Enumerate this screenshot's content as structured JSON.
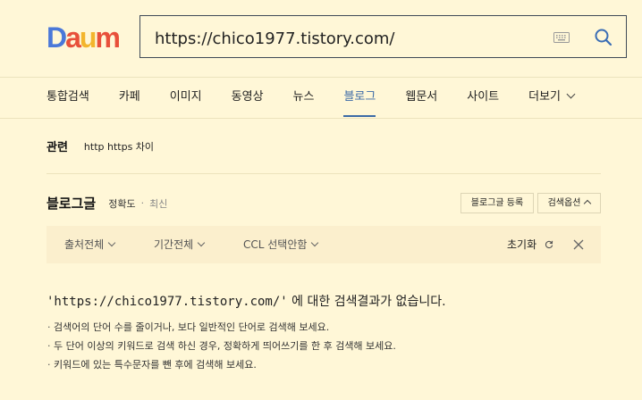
{
  "logo": {
    "text": "Daum",
    "letters": [
      {
        "ch": "D",
        "color": "#4a78d9"
      },
      {
        "ch": "a",
        "color": "#e8503a"
      },
      {
        "ch": "u",
        "color": "#f3b52d"
      },
      {
        "ch": "m",
        "color": "#e8503a"
      }
    ]
  },
  "search": {
    "query": "https://chico1977.tistory.com/",
    "keyboard_icon": "keyboard-icon",
    "search_icon": "search-icon"
  },
  "tabs": [
    {
      "label": "통합검색",
      "active": false
    },
    {
      "label": "카페",
      "active": false
    },
    {
      "label": "이미지",
      "active": false
    },
    {
      "label": "동영상",
      "active": false
    },
    {
      "label": "뉴스",
      "active": false
    },
    {
      "label": "블로그",
      "active": true
    },
    {
      "label": "웹문서",
      "active": false
    },
    {
      "label": "사이트",
      "active": false
    },
    {
      "label": "더보기",
      "active": false,
      "has_dropdown": true
    }
  ],
  "related": {
    "label": "관련",
    "keyword": "http https 차이"
  },
  "blog": {
    "title": "블로그글",
    "sort_accuracy": "정확도",
    "sort_dot": "·",
    "sort_latest": "최신",
    "register_button": "블로그글 등록",
    "options_button": "검색옵션"
  },
  "filters": {
    "source": "출처전체",
    "period": "기간전체",
    "ccl": "CCL 선택안함",
    "reset": "초기화"
  },
  "result": {
    "query_quoted": "'https://chico1977.tistory.com/'",
    "message": " 에 대한 검색결과가 없습니다.",
    "tips": [
      "검색어의 단어 수를 줄이거나, 보다 일반적인 단어로 검색해 보세요.",
      "두 단어 이상의 키워드로 검색 하신 경우, 정확하게 띄어쓰기를 한 후 검색해 보세요.",
      "키워드에 있는 특수문자를 뺀 후에 검색해 보세요."
    ]
  },
  "colors": {
    "background": "#fff7d7",
    "filter_bar": "#fbefcd",
    "active_tab": "#3b6aa6",
    "search_border": "#3f4a57"
  }
}
